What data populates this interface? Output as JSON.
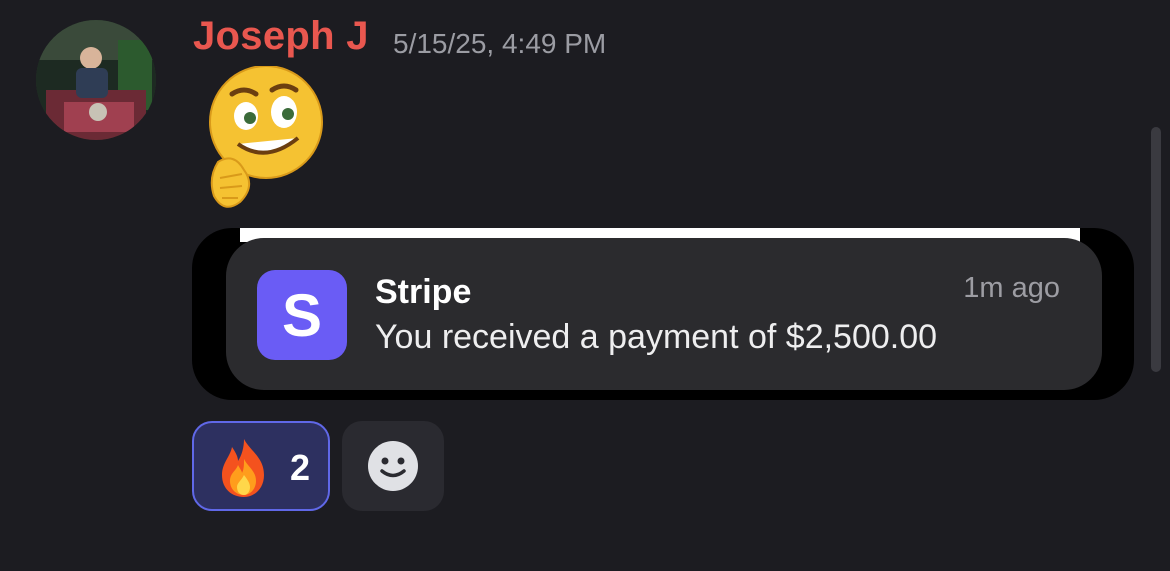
{
  "message": {
    "author": "Joseph J",
    "author_color": "#e9574f",
    "timestamp": "5/15/25, 4:49 PM",
    "emoji": "thinking-face-emoji"
  },
  "notification": {
    "app_name": "Stripe",
    "icon_letter": "S",
    "icon_color": "#6a5cf5",
    "time": "1m ago",
    "body": "You received a payment of $2,500.00"
  },
  "reactions": [
    {
      "emoji": "fire-icon",
      "count": "2",
      "selected": true
    }
  ],
  "add_reaction": {
    "icon": "smiley-icon"
  }
}
